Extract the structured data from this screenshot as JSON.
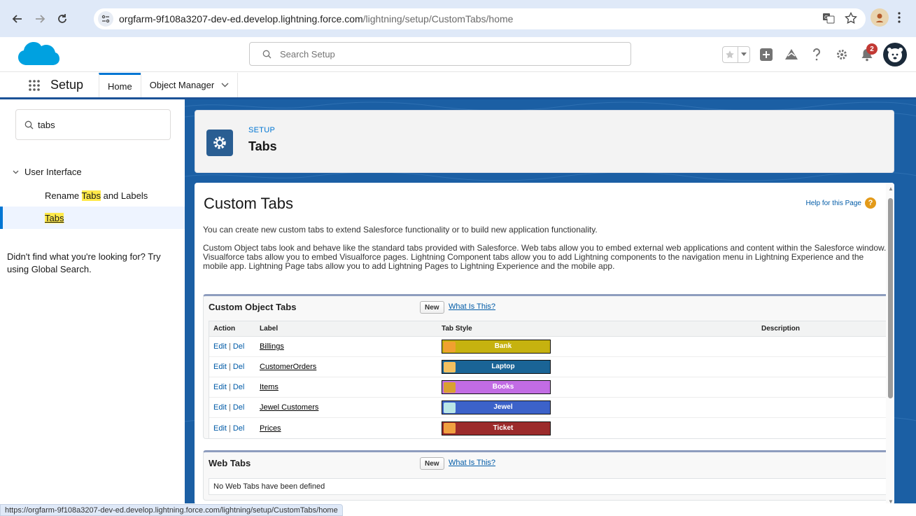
{
  "browser": {
    "url_host": "orgfarm-9f108a3207-dev-ed.develop.lightning.force.com",
    "url_path": "/lightning/setup/CustomTabs/home"
  },
  "header": {
    "search_placeholder": "Search Setup",
    "notification_count": "2"
  },
  "appnav": {
    "app_name": "Setup",
    "tabs": [
      "Home",
      "Object Manager"
    ]
  },
  "sidebar": {
    "quickfind_value": "tabs",
    "group_label": "User Interface",
    "item1_pre": "Rename ",
    "item1_hl": "Tabs",
    "item1_post": " and Labels",
    "item2": "Tabs",
    "help_text": "Didn't find what you're looking for? Try using Global Search."
  },
  "pageheader": {
    "eyebrow": "SETUP",
    "title": "Tabs"
  },
  "main": {
    "title": "Custom Tabs",
    "help_link": "Help for this Page",
    "help_icon": "?",
    "intro1": "You can create new custom tabs to extend Salesforce functionality or to build new application functionality.",
    "intro2": "Custom Object tabs look and behave like the standard tabs provided with Salesforce. Web tabs allow you to embed external web applications and content within the Salesforce window. Visualforce tabs allow you to embed Visualforce pages. Lightning Component tabs allow you to add Lightning components to the navigation menu in Lightning Experience and the mobile app. Lightning Page tabs allow you to add Lightning Pages to Lightning Experience and the mobile app."
  },
  "custom_object_tabs": {
    "title": "Custom Object Tabs",
    "new_label": "New",
    "what_is_this": "What Is This?",
    "columns": [
      "Action",
      "Label",
      "Tab Style",
      "Description"
    ],
    "edit_label": "Edit",
    "del_label": "Del",
    "separator": "|",
    "rows": [
      {
        "label": "Billings",
        "style_name": "Bank",
        "color": "#c6b20f",
        "icon_color": "#f0a030"
      },
      {
        "label": "CustomerOrders",
        "style_name": "Laptop",
        "color": "#1a6496",
        "icon_color": "#f2c060"
      },
      {
        "label": "Items",
        "style_name": "Books",
        "color": "#c26ce4",
        "icon_color": "#d9a030"
      },
      {
        "label": "Jewel Customers",
        "style_name": "Jewel",
        "color": "#3c62c9",
        "icon_color": "#b9e6e6"
      },
      {
        "label": "Prices",
        "style_name": "Ticket",
        "color": "#9c2b2b",
        "icon_color": "#f0a040"
      }
    ]
  },
  "web_tabs": {
    "title": "Web Tabs",
    "new_label": "New",
    "what_is_this": "What Is This?",
    "empty": "No Web Tabs have been defined"
  },
  "status": {
    "hover_url": "https://orgfarm-9f108a3207-dev-ed.develop.lightning.force.com/lightning/setup/CustomTabs/home"
  }
}
